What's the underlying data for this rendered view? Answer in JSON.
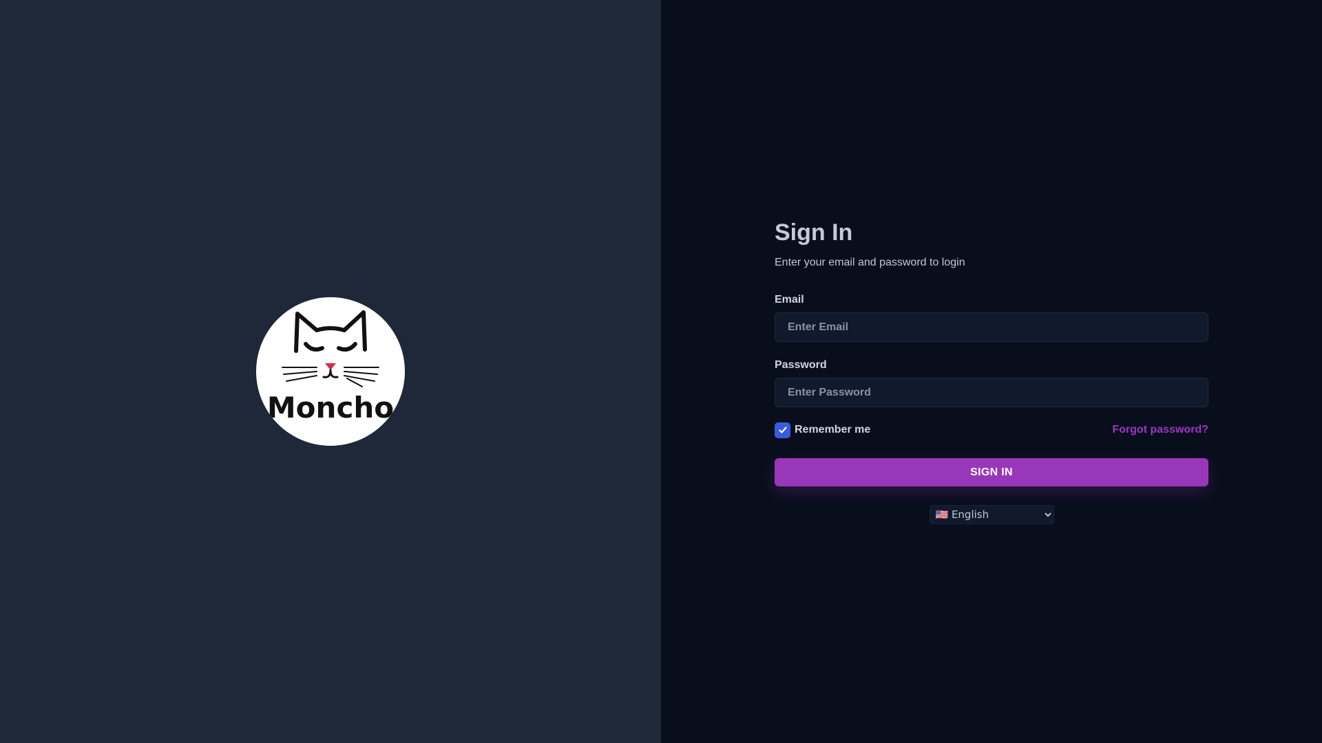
{
  "brand": {
    "logo_text": "Moncho",
    "logo_icon": "cat-face-icon"
  },
  "signin": {
    "title": "Sign In",
    "subtitle": "Enter your email and password to login",
    "email_label": "Email",
    "email_placeholder": "Enter Email",
    "email_value": "",
    "password_label": "Password",
    "password_placeholder": "Enter Password",
    "password_value": "",
    "remember_label": "Remember me",
    "remember_checked": true,
    "forgot_label": "Forgot password?",
    "submit_label": "SIGN IN"
  },
  "language": {
    "selected": "🇺🇸 English"
  },
  "colors": {
    "left_background": "#1f2839",
    "right_background": "#090e1d",
    "accent": "#9838b8",
    "link": "#9e36c3",
    "checkbox": "#3b5bdb"
  }
}
